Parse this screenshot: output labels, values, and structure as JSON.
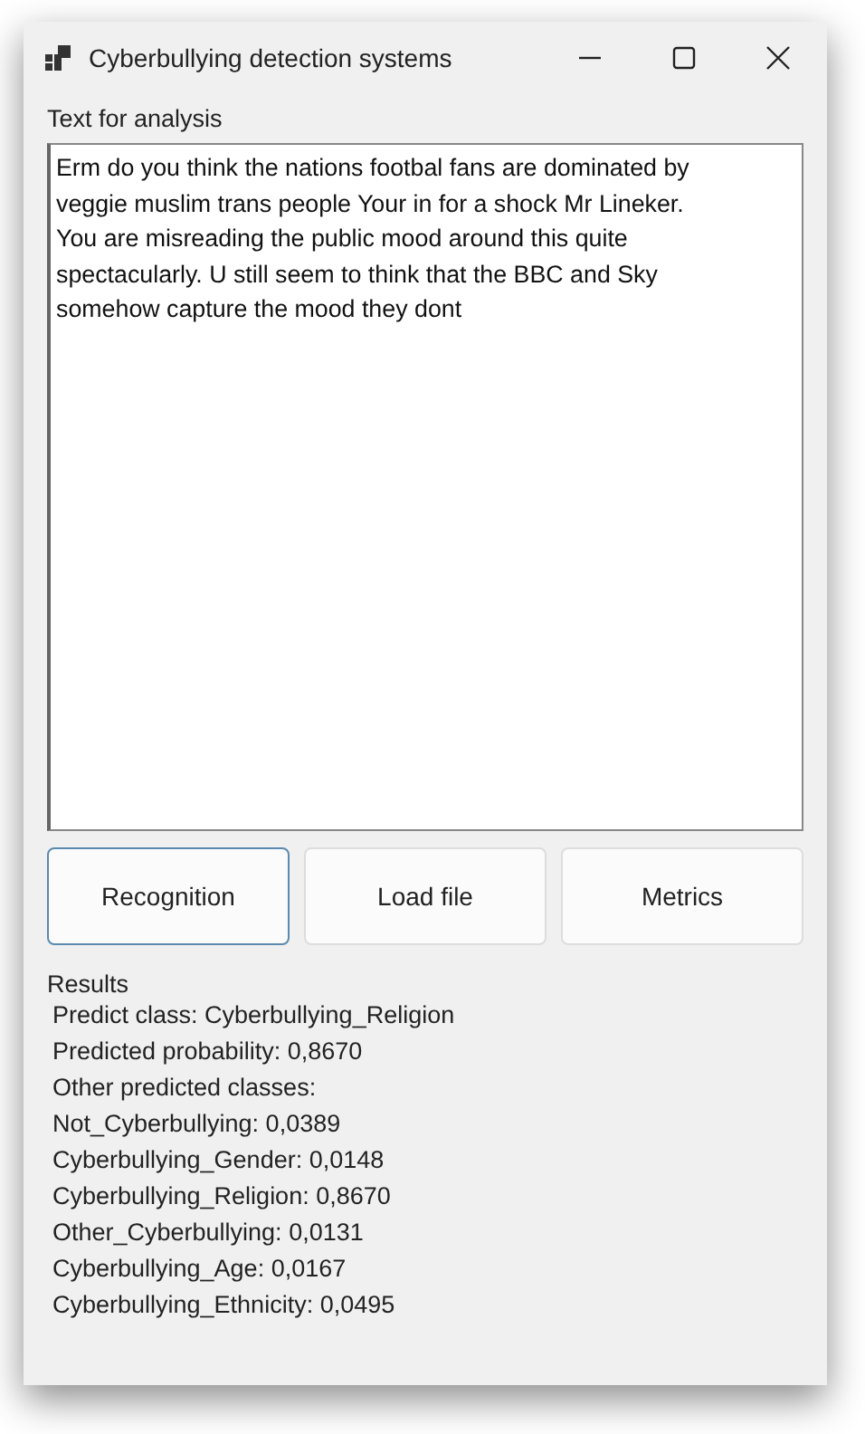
{
  "window": {
    "title": "Cyberbullying detection systems"
  },
  "input": {
    "label": "Text for analysis",
    "lines": [
      "Erm do you think the nations footbal fans are dominated by",
      "veggie muslim trans people Your in for a shock Mr Lineker.",
      "You are misreading the public mood around this quite",
      "spectacularly. U still seem to think that the BBC and Sky",
      "somehow capture the mood they dont"
    ]
  },
  "buttons": [
    {
      "label": "Recognition",
      "focused": true
    },
    {
      "label": "Load file",
      "focused": false
    },
    {
      "label": "Metrics",
      "focused": false
    }
  ],
  "results": {
    "label": "Results",
    "lines": [
      "Predict class: Cyberbullying_Religion",
      "Predicted probability: 0,8670",
      "Other predicted classes:",
      "Not_Cyberbullying: 0,0389",
      "Cyberbullying_Gender: 0,0148",
      "Cyberbullying_Religion: 0,8670",
      "Other_Cyberbullying: 0,0131",
      "Cyberbullying_Age: 0,0167",
      "Cyberbullying_Ethnicity: 0,0495"
    ]
  }
}
